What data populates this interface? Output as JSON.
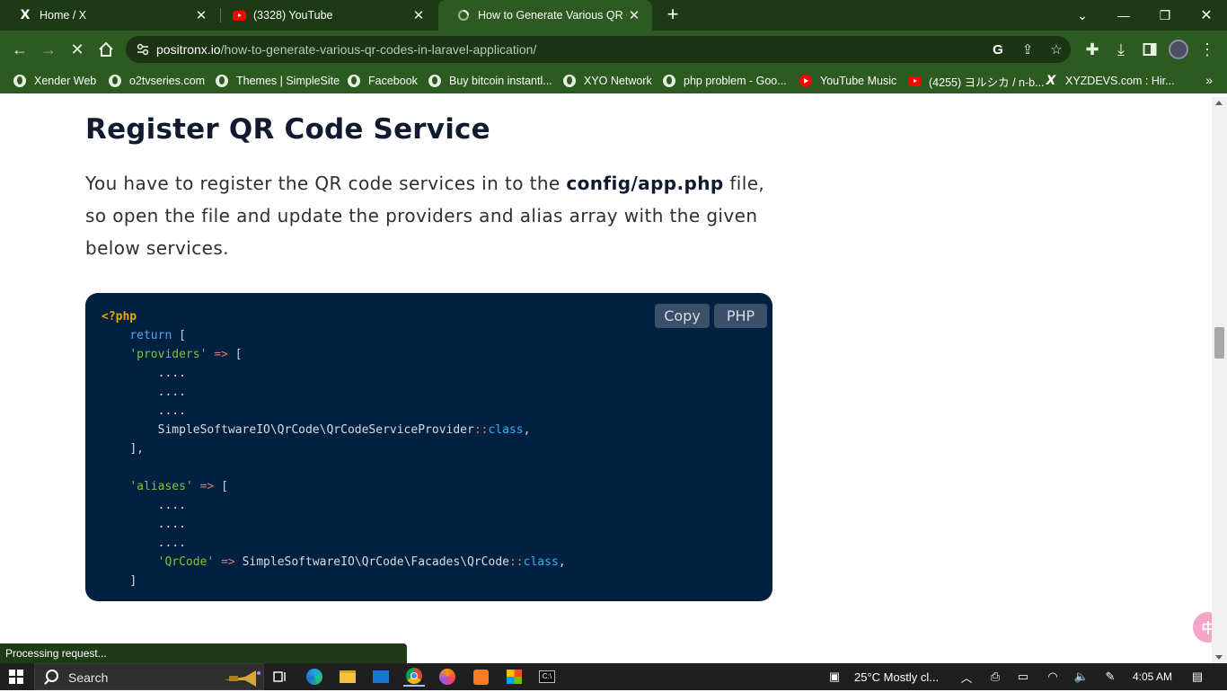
{
  "tabs": [
    {
      "title": "Home / X",
      "icon": "x-logo-icon"
    },
    {
      "title": "(3328) YouTube",
      "icon": "youtube-icon"
    },
    {
      "title": "How to Generate Various QR Codes in Laravel",
      "icon": "loading-icon",
      "active": true
    }
  ],
  "url": {
    "domain": "positronx.io",
    "path": "/how-to-generate-various-qr-codes-in-laravel-application/"
  },
  "bookmarks": [
    {
      "label": "Xender Web",
      "icon": "globe-icon"
    },
    {
      "label": "o2tvseries.com",
      "icon": "globe-icon"
    },
    {
      "label": "Themes | SimpleSite",
      "icon": "globe-icon"
    },
    {
      "label": "Facebook",
      "icon": "globe-icon"
    },
    {
      "label": "Buy bitcoin instantl...",
      "icon": "globe-icon"
    },
    {
      "label": "XYO Network",
      "icon": "globe-icon"
    },
    {
      "label": "php problem - Goo...",
      "icon": "globe-icon"
    },
    {
      "label": "YouTube Music",
      "icon": "youtube-music-icon"
    },
    {
      "label": "(4255) ヨルシカ / n-b...",
      "icon": "youtube-icon"
    },
    {
      "label": "XYZDEVS.com : Hir...",
      "icon": "xyzdevs-icon"
    }
  ],
  "article": {
    "heading": "Register QR Code Service",
    "para_before": "You have to register the QR code services in to the ",
    "para_strong": "config/app.php",
    "para_after": " file, so open the file and update the providers and alias array with the given below services."
  },
  "code": {
    "copy_label": "Copy",
    "lang_label": "PHP",
    "open_tag": "<?php",
    "kw_return": "return",
    "bracket_open": "[",
    "providers_key": "'providers'",
    "arrow": "=>",
    "dots": "....",
    "provider_class": "SimpleSoftwareIO\\QrCode\\QrCodeServiceProvider",
    "scope": "::",
    "class_kw": "class",
    "comma": ",",
    "close_bracket_comma": "],",
    "aliases_key": "'aliases'",
    "alias_key": "'QrCode'",
    "facade_class": "SimpleSoftwareIO\\QrCode\\Facades\\QrCode",
    "close_bracket": "]"
  },
  "status_text": "Processing request...",
  "taskbar": {
    "search_label": "Search",
    "weather": "25°C  Mostly cl...",
    "time": "4:05 AM"
  },
  "colors": {
    "browser_frame": "#1c3a14",
    "toolbar": "#2d5a20",
    "code_bg": "#022040",
    "heading": "#111a2e"
  }
}
